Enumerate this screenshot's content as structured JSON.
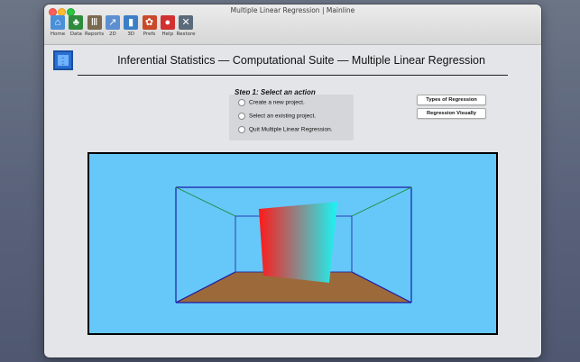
{
  "window": {
    "title": "Multiple Linear Regression | Mainline"
  },
  "toolbar": {
    "items": [
      {
        "label": "Home",
        "icon": "house-icon",
        "color": "#4a90d9",
        "glyph": "⌂"
      },
      {
        "label": "Data",
        "icon": "tree-icon",
        "color": "#2e8b3d",
        "glyph": "♣"
      },
      {
        "label": "Reports",
        "icon": "columns-icon",
        "color": "#7a6a4f",
        "glyph": "Ⅲ"
      },
      {
        "label": "2D",
        "icon": "line-chart-icon",
        "color": "#5b8fd1",
        "glyph": "↗"
      },
      {
        "label": "3D",
        "icon": "bar-chart-icon",
        "color": "#3c7fc8",
        "glyph": "▮"
      },
      {
        "label": "Prefs",
        "icon": "leaf-icon",
        "color": "#c84a2a",
        "glyph": "✿"
      },
      {
        "label": "Help",
        "icon": "help-button-icon",
        "color": "#d23030",
        "glyph": "●"
      },
      {
        "label": "Restore",
        "icon": "tools-icon",
        "color": "#5a6a7a",
        "glyph": "✕"
      }
    ]
  },
  "header": {
    "title": "Inferential Statistics — Computational Suite — Multiple Linear Regression"
  },
  "step1": {
    "label": "Step 1: Select an action",
    "options": [
      {
        "label": "Create a new project."
      },
      {
        "label": "Select an existing project."
      },
      {
        "label": "Quit Multiple Linear Regression."
      }
    ]
  },
  "side_buttons": {
    "types": "Types of Regression",
    "visually": "Regression Visually"
  },
  "colors": {
    "scene_background": "#66c8f8",
    "floor": "#9c6a3a",
    "plane_start": "#ff1a1a",
    "plane_end": "#1af5f5",
    "room_lines": "#1a1aa8",
    "diagonals": "#1a8a3a"
  }
}
